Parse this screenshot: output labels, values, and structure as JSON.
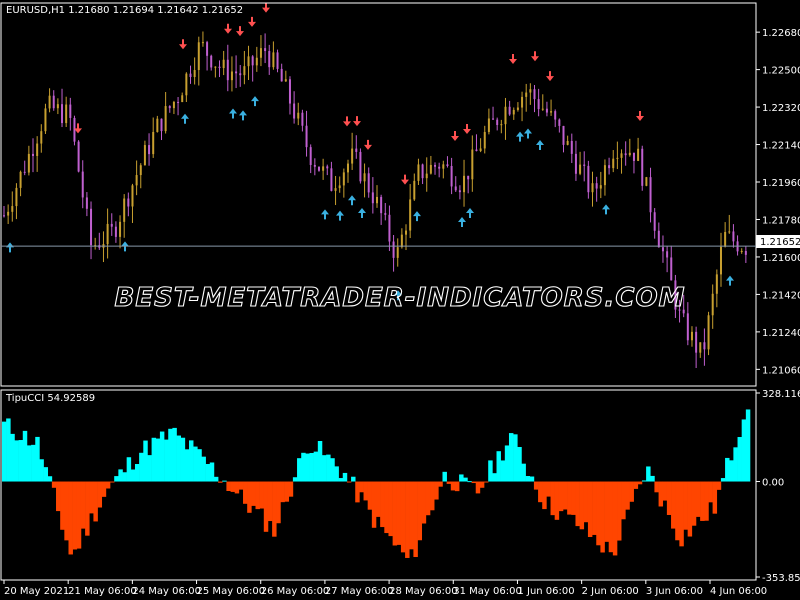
{
  "main_chart": {
    "symbol_label": "EURUSD,H1  1.21680 1.21694 1.21642 1.21652",
    "current_price_label": "1.21652",
    "price_ticks": [
      "1.22680",
      "1.22500",
      "1.22320",
      "1.22140",
      "1.21960",
      "1.21780",
      "1.21600",
      "1.21420",
      "1.21240",
      "1.21060"
    ],
    "watermark": "BEST-METATRADER-INDICATORS.COM"
  },
  "indicator": {
    "label": "TipuCCI 54.92589",
    "ticks": [
      "328.116",
      "0.00",
      "-353.85769"
    ]
  },
  "time_axis": {
    "labels": [
      "20 May 2021",
      "21 May 06:00",
      "24 May 06:00",
      "25 May 06:00",
      "26 May 06:00",
      "27 May 06:00",
      "28 May 06:00",
      "31 May 06:00",
      "1 Jun 06:00",
      "2 Jun 06:00",
      "3 Jun 06:00",
      "4 Jun 06:00"
    ]
  },
  "colors": {
    "background": "#000000",
    "bull_candle": "#c8a030",
    "bear_candle": "#c060d0",
    "neutral_candle": "#60a040",
    "buy_arrow": "#3ab0e0",
    "sell_arrow": "#ff5050",
    "cci_positive": "#00ffff",
    "cci_negative": "#ff4500",
    "current_price_line": "#8899aa",
    "axis": "#ffffff"
  },
  "chart_data": [
    {
      "type": "line",
      "title": "EURUSD,H1",
      "x": [
        "20 May",
        "20 May",
        "21 May",
        "21 May",
        "21 May",
        "24 May",
        "24 May",
        "24 May",
        "25 May",
        "25 May",
        "25 May",
        "26 May",
        "26 May",
        "26 May",
        "27 May",
        "27 May",
        "27 May",
        "28 May",
        "28 May",
        "28 May",
        "31 May",
        "31 May",
        "31 May",
        "1 Jun",
        "1 Jun",
        "1 Jun",
        "2 Jun",
        "2 Jun",
        "2 Jun",
        "3 Jun",
        "3 Jun",
        "3 Jun",
        "4 Jun",
        "4 Jun",
        "4 Jun"
      ],
      "series": [
        {
          "values": [
            1.218,
            1.2205,
            1.2232,
            1.2228,
            1.2165,
            1.2172,
            1.2198,
            1.2222,
            1.2238,
            1.2262,
            1.225,
            1.2248,
            1.226,
            1.2238,
            1.221,
            1.2195,
            1.2208,
            1.2188,
            1.216,
            1.22,
            1.2205,
            1.2195,
            1.2218,
            1.2232,
            1.224,
            1.2228,
            1.221,
            1.219,
            1.2214,
            1.221,
            1.217,
            1.213,
            1.2112,
            1.217,
            1.2165
          ]
        }
      ],
      "ylim": [
        1.2098,
        1.2282
      ],
      "buy_arrow_count": 17,
      "sell_arrow_count": 17,
      "current_price": 1.21652
    },
    {
      "type": "bar",
      "title": "TipuCCI 54.92589",
      "x": [
        "20 May",
        "21 May",
        "21 May",
        "24 May",
        "24 May",
        "25 May",
        "25 May",
        "26 May",
        "26 May",
        "27 May",
        "27 May",
        "28 May",
        "28 May",
        "31 May",
        "31 May",
        "1 Jun",
        "1 Jun",
        "2 Jun",
        "2 Jun",
        "3 Jun",
        "3 Jun",
        "4 Jun",
        "4 Jun"
      ],
      "values": [
        210,
        140,
        -280,
        -40,
        110,
        180,
        70,
        -60,
        -180,
        150,
        40,
        -150,
        -300,
        20,
        -40,
        170,
        -80,
        -160,
        -270,
        50,
        -210,
        -100,
        300
      ],
      "ylim": [
        -353.85769,
        328.116
      ]
    }
  ]
}
